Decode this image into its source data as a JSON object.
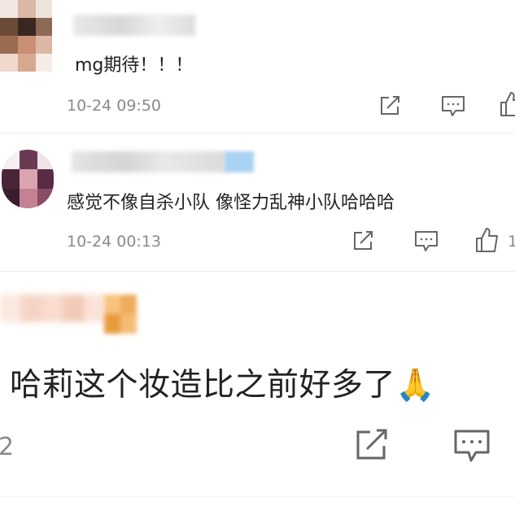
{
  "comments": [
    {
      "text": "mg期待！！！",
      "time": "10-24 09:50"
    },
    {
      "text": "感觉不像自杀小队 像怪力乱神小队哈哈哈",
      "time": "10-24 00:13",
      "like_count": "1"
    },
    {
      "text": "哈莉这个妆造比之前好多了🙏",
      "time": "2"
    }
  ],
  "icons": [
    "share-icon",
    "comment-icon",
    "like-icon"
  ]
}
